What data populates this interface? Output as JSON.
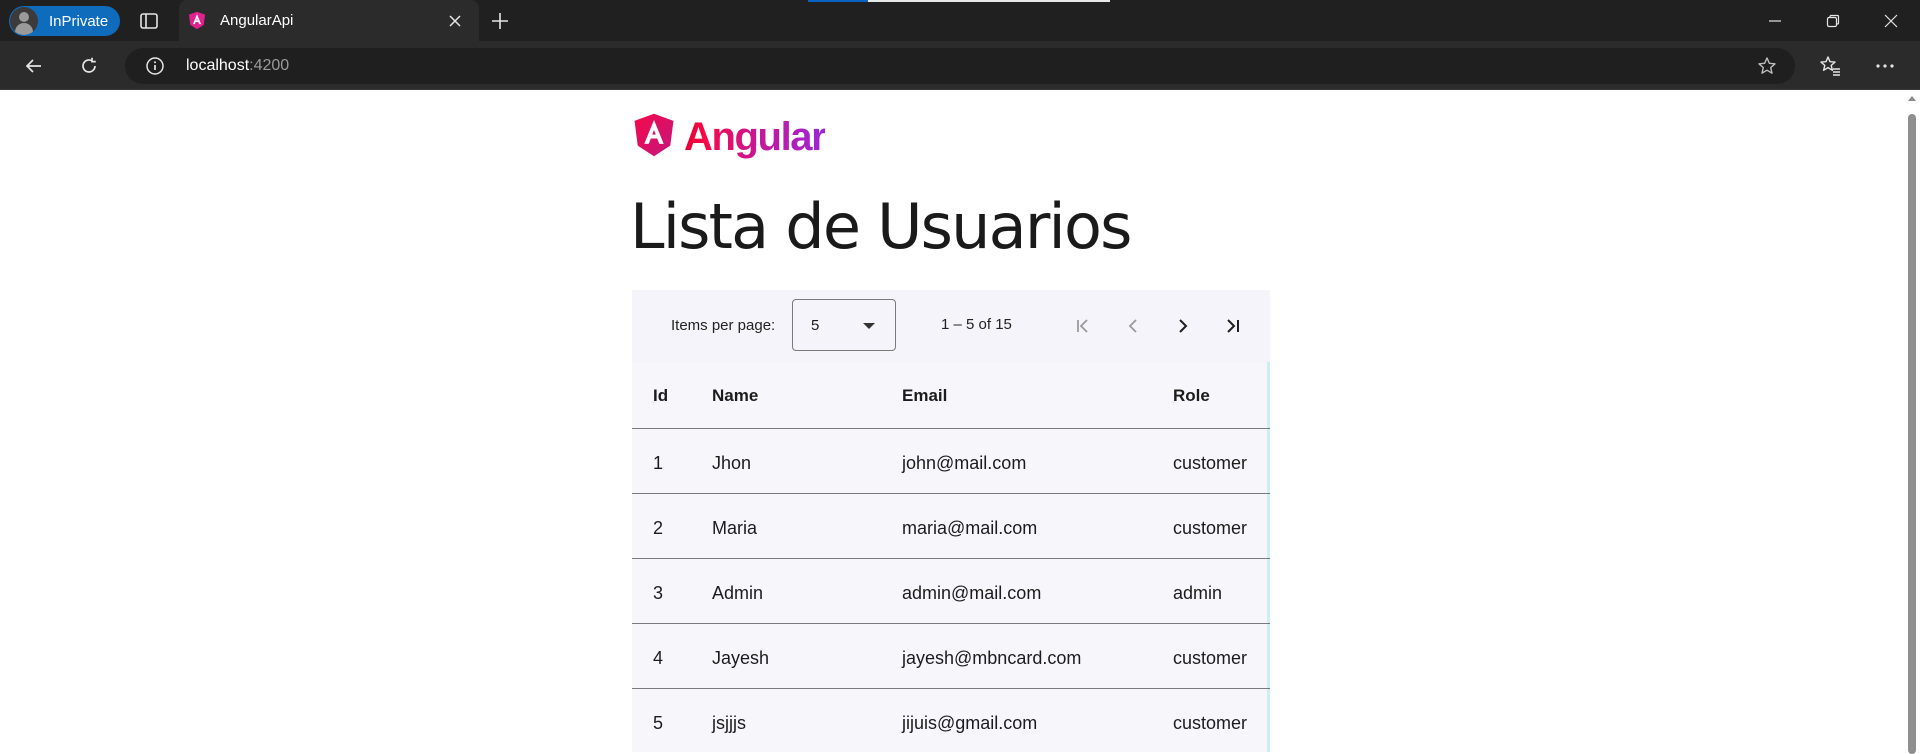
{
  "browser": {
    "inprivate_label": "InPrivate",
    "tab_title": "AngularApi",
    "url_host": "localhost",
    "url_port": ":4200"
  },
  "page": {
    "logo_text": "Angular",
    "heading": "Lista de Usuarios"
  },
  "paginator": {
    "items_per_page_label": "Items per page:",
    "page_size": "5",
    "range_label": "1 – 5 of 15"
  },
  "table": {
    "headers": [
      "Id",
      "Name",
      "Email",
      "Role"
    ],
    "rows": [
      {
        "id": "1",
        "name": "Jhon",
        "email": "john@mail.com",
        "role": "customer"
      },
      {
        "id": "2",
        "name": "Maria",
        "email": "maria@mail.com",
        "role": "customer"
      },
      {
        "id": "3",
        "name": "Admin",
        "email": "admin@mail.com",
        "role": "admin"
      },
      {
        "id": "4",
        "name": "Jayesh",
        "email": "jayesh@mbncard.com",
        "role": "customer"
      },
      {
        "id": "5",
        "name": "jsjjjs",
        "email": "jijuis@gmail.com",
        "role": "customer"
      }
    ]
  },
  "colors": {
    "brand_red": "#e40035",
    "brand_purple": "#9c27d6",
    "inprivate_blue": "#0f6cbd"
  }
}
